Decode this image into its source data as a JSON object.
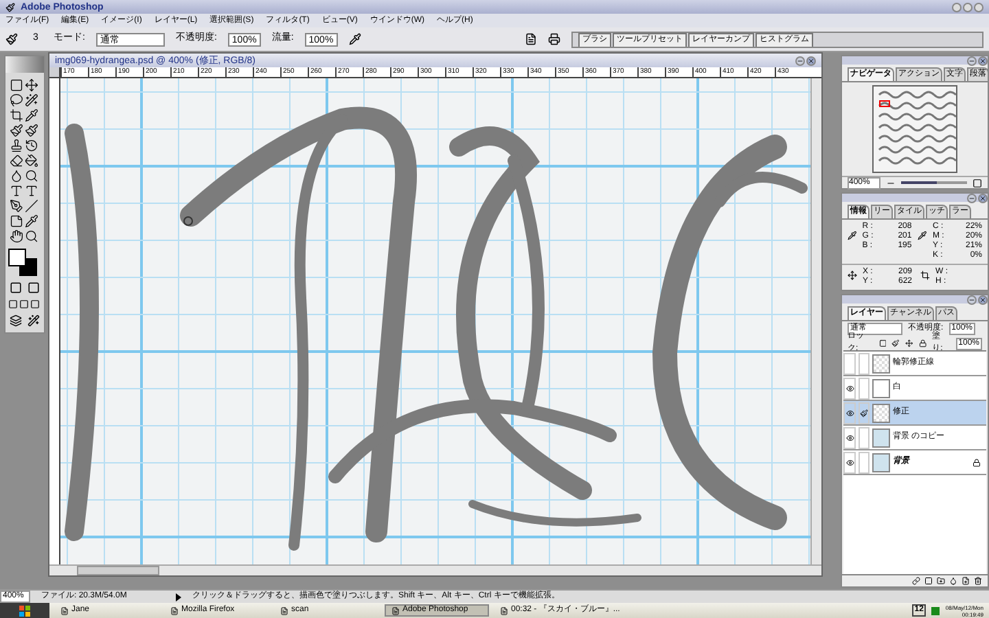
{
  "window": {
    "title": "Adobe Photoshop"
  },
  "menu": [
    "ファイル(F)",
    "編集(E)",
    "イメージ(I)",
    "レイヤー(L)",
    "選択範囲(S)",
    "フィルタ(T)",
    "ビュー(V)",
    "ウインドウ(W)",
    "ヘルプ(H)"
  ],
  "options": {
    "brush_size": "3",
    "mode_label": "モード:",
    "mode_value": "通常",
    "opacity_label": "不透明度:",
    "opacity_value": "100%",
    "flow_label": "流量:",
    "flow_value": "100%"
  },
  "palette_well": [
    "ブラシ",
    "ツールプリセット",
    "レイヤーカンプ",
    "ヒストグラム"
  ],
  "document": {
    "title": "img069-hydrangea.psd @ 400% (修正, RGB/8)",
    "ruler": [
      "170",
      "180",
      "190",
      "200",
      "210",
      "220",
      "230",
      "240",
      "250",
      "260",
      "270",
      "280",
      "290",
      "300",
      "310",
      "320",
      "330",
      "340",
      "350",
      "360",
      "370",
      "380",
      "390",
      "400",
      "410",
      "420",
      "430"
    ]
  },
  "navigator": {
    "tabs": [
      {
        "label": "ナビゲータ",
        "selected": true
      },
      {
        "label": "アクション",
        "selected": false
      },
      {
        "label": "文字",
        "selected": false
      },
      {
        "label": "段落",
        "selected": false
      }
    ],
    "zoom": "400%",
    "level": 0.55
  },
  "info": {
    "tabs": [
      {
        "label": "情報",
        "selected": true
      },
      {
        "label": "リー",
        "selected": false
      },
      {
        "label": "タイル",
        "selected": false
      },
      {
        "label": "ッチ",
        "selected": false
      },
      {
        "label": "ラー",
        "selected": false
      }
    ],
    "rgb": [
      {
        "label": "R :",
        "value": "208"
      },
      {
        "label": "G :",
        "value": "201"
      },
      {
        "label": "B :",
        "value": "195"
      }
    ],
    "cmyk": [
      {
        "label": "C :",
        "value": "22%"
      },
      {
        "label": "M :",
        "value": "20%"
      },
      {
        "label": "Y :",
        "value": "21%"
      },
      {
        "label": "K :",
        "value": "0%"
      }
    ],
    "xy": [
      {
        "label": "X :",
        "value": "209"
      },
      {
        "label": "Y :",
        "value": "622"
      }
    ],
    "wh": [
      {
        "label": "W :"
      },
      {
        "label": "H :"
      }
    ]
  },
  "layers": {
    "tabs": [
      {
        "label": "レイヤー",
        "selected": true
      },
      {
        "label": "チャンネル",
        "selected": false
      },
      {
        "label": "パス",
        "selected": false
      }
    ],
    "blend": "通常",
    "opacity_label": "不透明度:",
    "opacity_value": "100%",
    "lock_label": "ロック:",
    "fill_label": "塗り:",
    "fill_value": "100%",
    "items": [
      {
        "name": "輪郭修正線",
        "visible": false,
        "selected": false,
        "kind": "transparent"
      },
      {
        "name": "白",
        "visible": true,
        "selected": false,
        "kind": "white"
      },
      {
        "name": "修正",
        "visible": true,
        "selected": true,
        "kind": "transparent"
      },
      {
        "name": "背景 のコピー",
        "visible": true,
        "selected": false,
        "kind": "image"
      },
      {
        "name": "背景",
        "visible": true,
        "selected": false,
        "kind": "image",
        "locked": true
      }
    ]
  },
  "status": {
    "zoom": "400%",
    "file": "ファイル: 20.3M/54.0M",
    "message": "クリック＆ドラッグすると、描画色で塗りつぶします。Shift キー、Alt キー、Ctrl キーで機能拡張。"
  },
  "taskbar": {
    "tasks": [
      {
        "label": "Jane",
        "selected": false
      },
      {
        "label": "Mozilla Firefox",
        "selected": false
      },
      {
        "label": "scan",
        "selected": false
      },
      {
        "label": "Adobe Photoshop",
        "selected": true
      },
      {
        "label": "00:32 - 『スカイ・ブルー』...",
        "selected": false
      }
    ],
    "tray_badge": "12",
    "clock": [
      "08/May/12/Mon",
      "00:19:49"
    ]
  }
}
